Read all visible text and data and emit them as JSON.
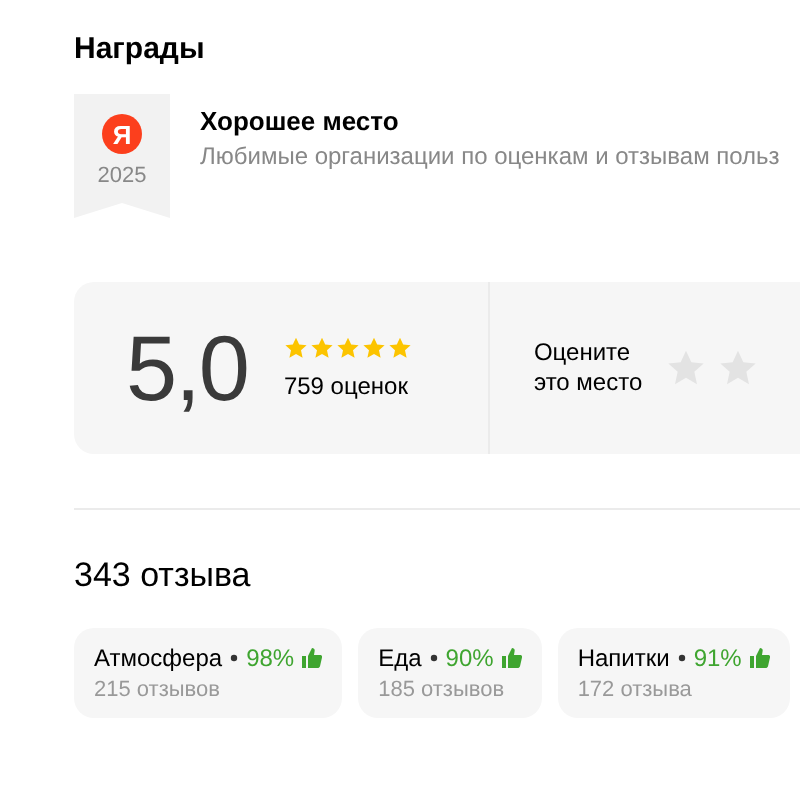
{
  "awards": {
    "title": "Награды",
    "badge": {
      "logo": "Я",
      "year": "2025"
    },
    "name": "Хорошее место",
    "description": "Любимые организации по оценкам и отзывам польз"
  },
  "rating": {
    "score": "5,0",
    "stars": 5,
    "count": "759 оценок",
    "prompt": "Оцените это место"
  },
  "reviews": {
    "title": "343 отзыва",
    "categories": [
      {
        "name": "Атмосфера",
        "percent": "98%",
        "count": "215 отзывов"
      },
      {
        "name": "Еда",
        "percent": "90%",
        "count": "185 отзывов"
      },
      {
        "name": "Напитки",
        "percent": "91%",
        "count": "172 отзыва"
      }
    ]
  }
}
